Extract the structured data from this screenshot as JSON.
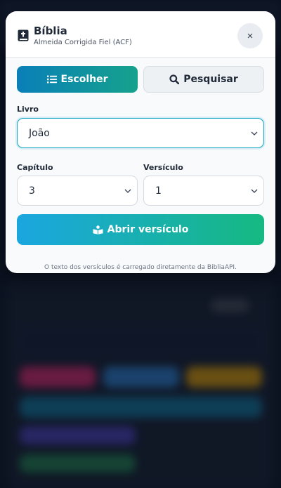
{
  "header": {
    "title": "Bíblia",
    "subtitle": "Almeida Corrigida Fiel (ACF)",
    "close_label": "×"
  },
  "tabs": [
    {
      "label": "Escolher",
      "icon": "list-icon",
      "active": true
    },
    {
      "label": "Pesquisar",
      "icon": "search-icon",
      "active": false
    }
  ],
  "form": {
    "book": {
      "label": "Livro",
      "value": "João"
    },
    "chapter": {
      "label": "Capítulo",
      "value": "3"
    },
    "verse": {
      "label": "Versículo",
      "value": "1"
    }
  },
  "open_button": {
    "label": "Abrir versículo",
    "icon": "book-reader-icon"
  },
  "footer": {
    "note": "O texto dos versículos é carregado diretamente da BibliaAPI."
  },
  "colors": {
    "accent_start": "#0a7fb8",
    "accent_end": "#15a28c",
    "button_start": "#1ba6e0",
    "button_end": "#16b981",
    "focus_border": "#1aa6c4"
  }
}
